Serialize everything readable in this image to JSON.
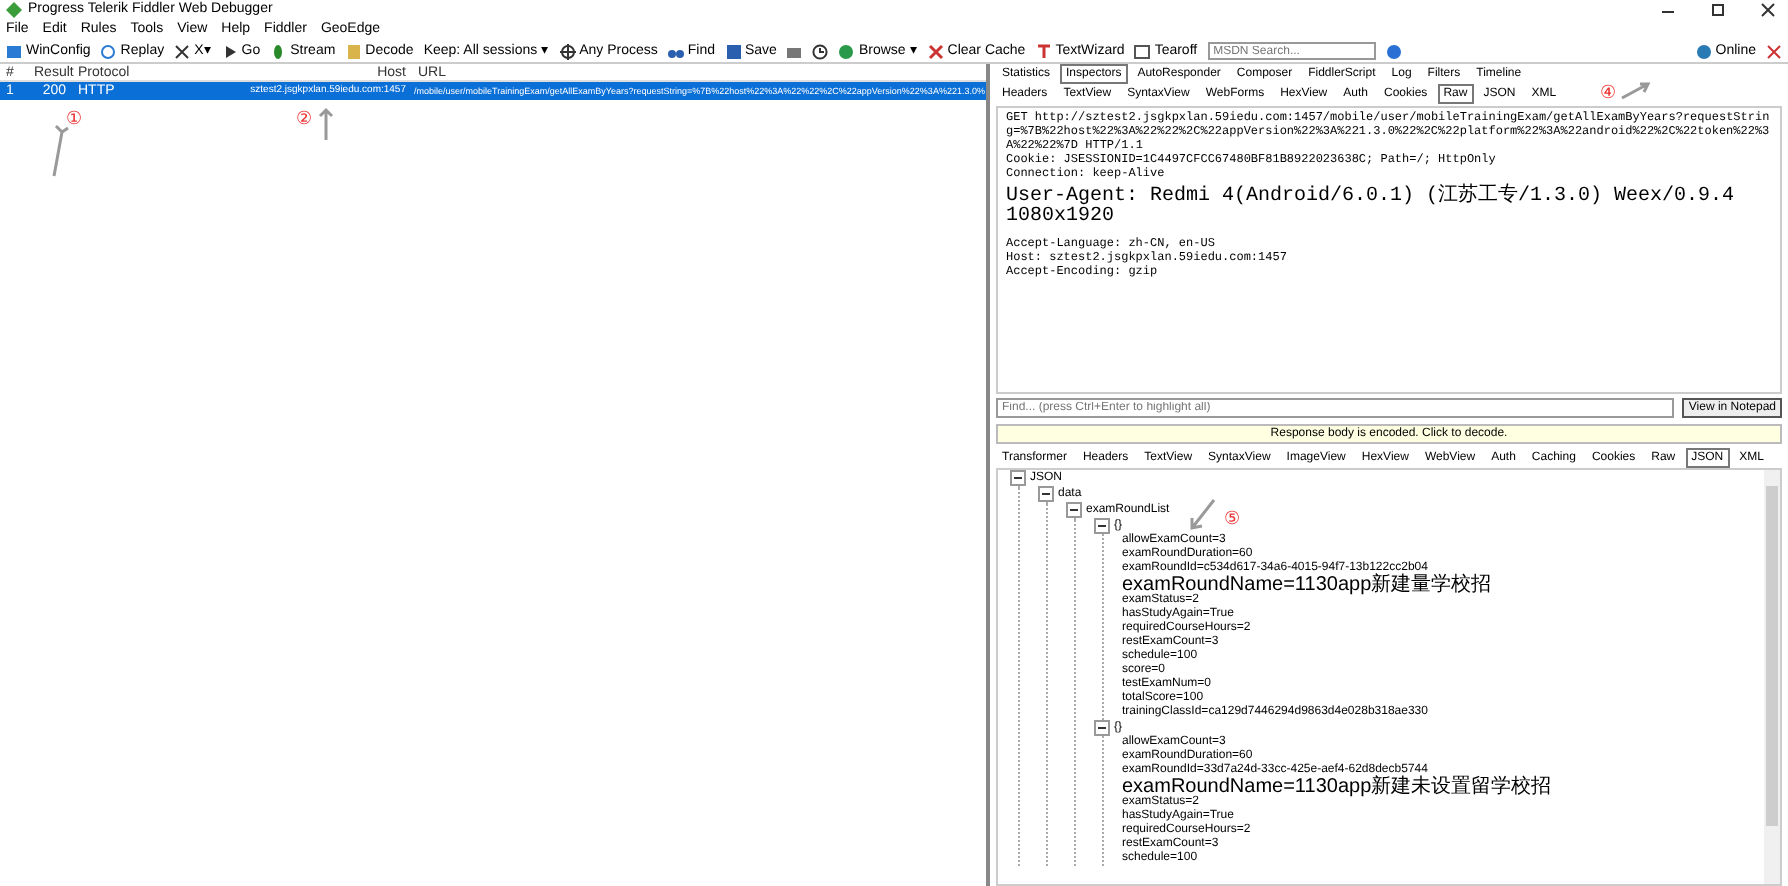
{
  "window": {
    "title": "Progress Telerik Fiddler Web Debugger",
    "status": "Online"
  },
  "menu": [
    "File",
    "Edit",
    "Rules",
    "Tools",
    "View",
    "Help",
    "Fiddler",
    "GeoEdge"
  ],
  "toolbar": [
    {
      "label": "WinConfig"
    },
    {
      "label": "Replay"
    },
    {
      "label": "X▾"
    },
    {
      "label": "Go"
    },
    {
      "label": "Stream"
    },
    {
      "label": "Decode"
    },
    {
      "label": "Keep: All sessions ▾"
    },
    {
      "label": "Any Process"
    },
    {
      "label": "Find"
    },
    {
      "label": "Save"
    },
    {
      "label": "Browse ▾"
    },
    {
      "label": "Clear Cache"
    },
    {
      "label": "TextWizard"
    },
    {
      "label": "Tearoff"
    }
  ],
  "search": {
    "placeholder": "MSDN Search..."
  },
  "sessions": {
    "columns": [
      "#",
      "Result",
      "Protocol",
      "Host",
      "URL"
    ],
    "rows": [
      {
        "num": "1",
        "result": "200",
        "protocol": "HTTP",
        "host": "sztest2.jsgkpxlan.59iedu.com:1457",
        "url": "/mobile/user/mobileTrainingExam/getAllExamByYears?requestString=%7B%22host%22%3A%22%22%2C%22appVersion%22%3A%221.3.0%",
        "selected": true
      }
    ]
  },
  "inspector_tabs": [
    {
      "label": "Statistics",
      "selected": false
    },
    {
      "label": "Inspectors",
      "selected": true
    },
    {
      "label": "AutoResponder",
      "selected": false
    },
    {
      "label": "Composer",
      "selected": false
    },
    {
      "label": "FiddlerScript",
      "selected": false
    },
    {
      "label": "Log",
      "selected": false
    },
    {
      "label": "Filters",
      "selected": false
    },
    {
      "label": "Timeline",
      "selected": false
    }
  ],
  "request_tabs": [
    {
      "label": "Headers",
      "selected": false
    },
    {
      "label": "TextView",
      "selected": false
    },
    {
      "label": "SyntaxView",
      "selected": false
    },
    {
      "label": "WebForms",
      "selected": false
    },
    {
      "label": "HexView",
      "selected": false
    },
    {
      "label": "Auth",
      "selected": false
    },
    {
      "label": "Cookies",
      "selected": false
    },
    {
      "label": "Raw",
      "selected": true
    },
    {
      "label": "JSON",
      "selected": false
    },
    {
      "label": "XML",
      "selected": false
    }
  ],
  "request": {
    "method": "GET",
    "url": "http://sztest2.jsgkpxlan.59iedu.com:1457/mobile/user/mobileTrainingExam/getAllExamByYears?requestString=%7B%22host%22%3A%22%22%2C%22appVersion%22%3A%221.3.0%22%2C%22platform%22%3A%22android%22%2C%22token%22%3A%22%22%7D",
    "version": "HTTP/1.1",
    "header_groups": [
      [
        "Cookie: JSESSIONID=1C4497CFCC67480BF81B8922023638C; Path=/; HttpOnly",
        "Connection: keep-Alive"
      ],
      [
        "User-Agent: Redmi 4(Android/6.0.1) (江苏工专/1.3.0) Weex/0.9.4 1080x1920"
      ],
      [
        "Accept-Language: zh-CN, en-US",
        "Host: sztest2.jsgkpxlan.59iedu.com:1457",
        "Accept-Encoding: gzip"
      ]
    ]
  },
  "find": {
    "placeholder": "Find... (press Ctrl+Enter to highlight all)",
    "button": "View in Notepad"
  },
  "notice": "Response body is encoded. Click to decode.",
  "response_tabs": [
    {
      "label": "Transformer",
      "selected": false
    },
    {
      "label": "Headers",
      "selected": false
    },
    {
      "label": "TextView",
      "selected": false
    },
    {
      "label": "SyntaxView",
      "selected": false
    },
    {
      "label": "ImageView",
      "selected": false
    },
    {
      "label": "HexView",
      "selected": false
    },
    {
      "label": "WebView",
      "selected": false
    },
    {
      "label": "Auth",
      "selected": false
    },
    {
      "label": "Caching",
      "selected": false
    },
    {
      "label": "Cookies",
      "selected": false
    },
    {
      "label": "Raw",
      "selected": false
    },
    {
      "label": "JSON",
      "selected": true
    },
    {
      "label": "XML",
      "selected": false
    }
  ],
  "tree": [
    {
      "label": "JSON",
      "expanded": true,
      "children": [
        {
          "label": "data",
          "expanded": true,
          "children": [
            {
              "label": "examRoundList",
              "expanded": true,
              "children": [
                {
                  "label": "{}",
                  "expanded": true,
                  "children": [
                    {
                      "label": "allowExamCount=3"
                    },
                    {
                      "label": "examRoundDuration=60"
                    },
                    {
                      "label": "examRoundId=c534d617-34a6-4015-94f7-13b122cc2b04"
                    },
                    {
                      "label": "examRoundName=1130app新建量学校招"
                    },
                    {
                      "label": "examStatus=2"
                    },
                    {
                      "label": "hasStudyAgain=True"
                    },
                    {
                      "label": "requiredCourseHours=2"
                    },
                    {
                      "label": "restExamCount=3"
                    },
                    {
                      "label": "schedule=100"
                    },
                    {
                      "label": "score=0"
                    },
                    {
                      "label": "testExamNum=0"
                    },
                    {
                      "label": "totalScore=100"
                    },
                    {
                      "label": "trainingClassId=ca129d7446294d9863d4e028b318ae330"
                    }
                  ]
                },
                {
                  "label": "{}",
                  "expanded": true,
                  "children": [
                    {
                      "label": "allowExamCount=3"
                    },
                    {
                      "label": "examRoundDuration=60"
                    },
                    {
                      "label": "examRoundId=33d7a24d-33cc-425e-aef4-62d8decb5744"
                    },
                    {
                      "label": "examRoundName=1130app新建未设置留学校招"
                    },
                    {
                      "label": "examStatus=2"
                    },
                    {
                      "label": "hasStudyAgain=True"
                    },
                    {
                      "label": "requiredCourseHours=2"
                    },
                    {
                      "label": "restExamCount=3"
                    },
                    {
                      "label": "schedule=100"
                    }
                  ]
                }
              ]
            }
          ]
        }
      ]
    }
  ],
  "annotations": [
    "①",
    "②",
    "④",
    "⑤"
  ]
}
